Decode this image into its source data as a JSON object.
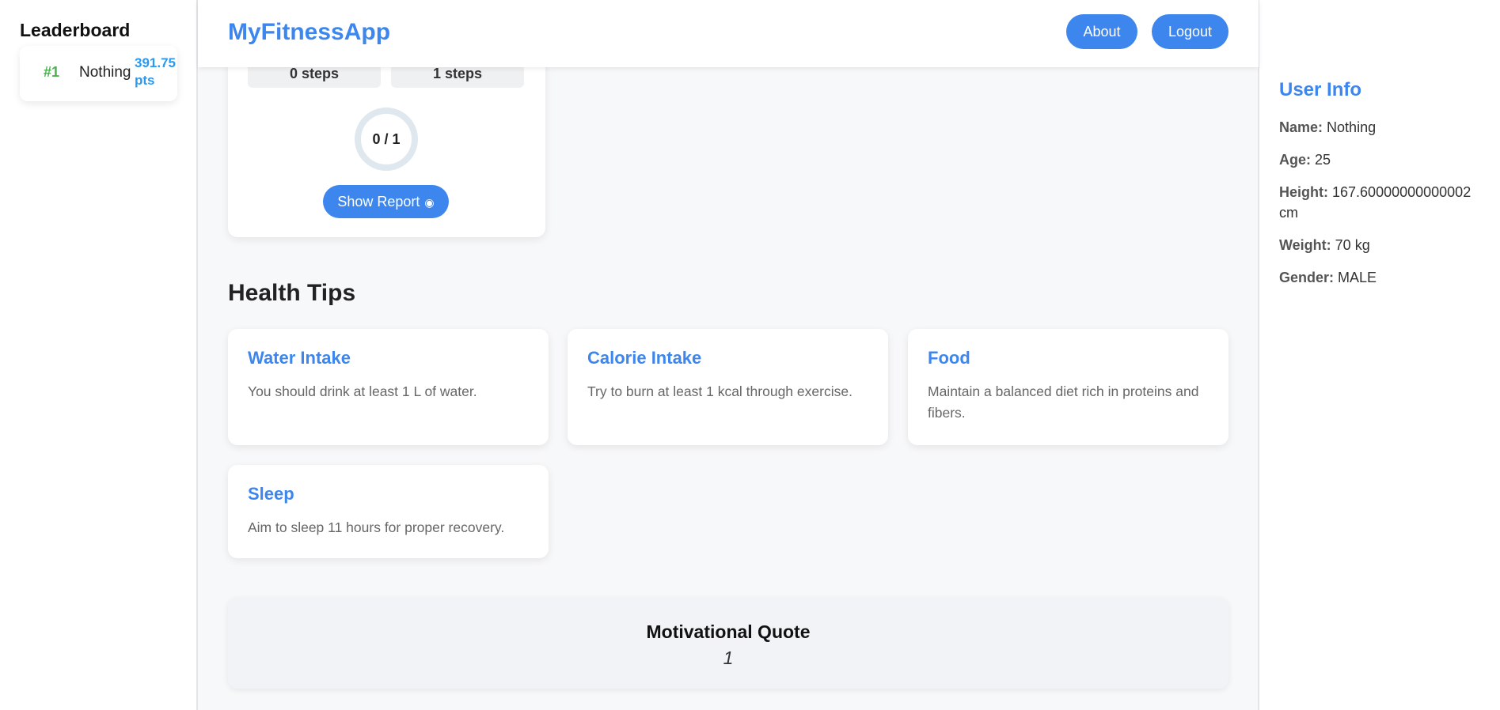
{
  "leaderboard": {
    "title": "Leaderboard",
    "entries": [
      {
        "rank": "#1",
        "name": "Nothing",
        "points": "391.75 pts"
      }
    ]
  },
  "header": {
    "brand": "MyFitnessApp",
    "about_label": "About",
    "logout_label": "Logout"
  },
  "progress": {
    "steps_current": "0 steps",
    "steps_goal": "1 steps",
    "ring_text": "0 / 1",
    "ring_progress": 0,
    "report_button_label": "Show Report",
    "report_button_icon": "eye-icon"
  },
  "health_tips": {
    "title": "Health Tips",
    "tips": [
      {
        "title": "Water Intake",
        "text": "You should drink at least 1 L of water."
      },
      {
        "title": "Calorie Intake",
        "text": "Try to burn at least 1 kcal through exercise."
      },
      {
        "title": "Food",
        "text": "Maintain a balanced diet rich in proteins and fibers."
      },
      {
        "title": "Sleep",
        "text": "Aim to sleep 11 hours for proper recovery."
      }
    ]
  },
  "quote": {
    "title": "Motivational Quote",
    "text": "1"
  },
  "user_info": {
    "title": "User Info",
    "name_label": "Name:",
    "name_value": "Nothing",
    "age_label": "Age:",
    "age_value": "25",
    "height_label": "Height:",
    "height_value": "167.60000000000002 cm",
    "weight_label": "Weight:",
    "weight_value": "70 kg",
    "gender_label": "Gender:",
    "gender_value": "MALE"
  },
  "colors": {
    "accent": "#3d86ee",
    "rank": "#4caf50",
    "points": "#2a9af0"
  }
}
